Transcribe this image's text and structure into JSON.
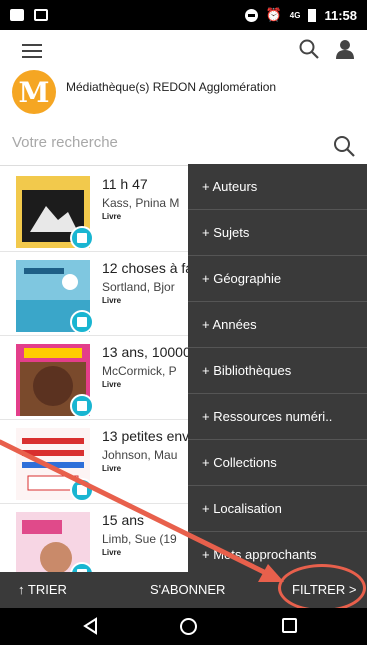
{
  "status_bar": {
    "time": "11:58",
    "network": "4G"
  },
  "header": {
    "org_name": "Médiathèque(s) REDON Agglomération",
    "logo_letter": "M"
  },
  "search": {
    "placeholder": "Votre recherche"
  },
  "results": [
    {
      "title": "11 h 47",
      "author": "Kass, Pnina M",
      "type": "Livre"
    },
    {
      "title": "12 choses à fa",
      "author": "Sortland, Bjor",
      "type": "Livre"
    },
    {
      "title": "13 ans, 10000",
      "author": "McCormick, P",
      "type": "Livre"
    },
    {
      "title": "13 petites env",
      "author": "Johnson, Mau",
      "type": "Livre"
    },
    {
      "title": "15 ans",
      "author": "Limb, Sue (19",
      "type": "Livre"
    }
  ],
  "filters": [
    "+ Auteurs",
    "+ Sujets",
    "+ Géographie",
    "+ Années",
    "+ Bibliothèques",
    "+ Ressources numéri..",
    "+ Collections",
    "+ Localisation",
    "+ Mots approchants"
  ],
  "toolbar": {
    "sort_label": "↑ TRIER",
    "subscribe_label": "S'ABONNER",
    "filter_label": "FILTRER >"
  },
  "colors": {
    "accent": "#19b5d1",
    "logo": "#f5a623",
    "annotation": "#e8604c",
    "panel": "#3a3a3a"
  }
}
